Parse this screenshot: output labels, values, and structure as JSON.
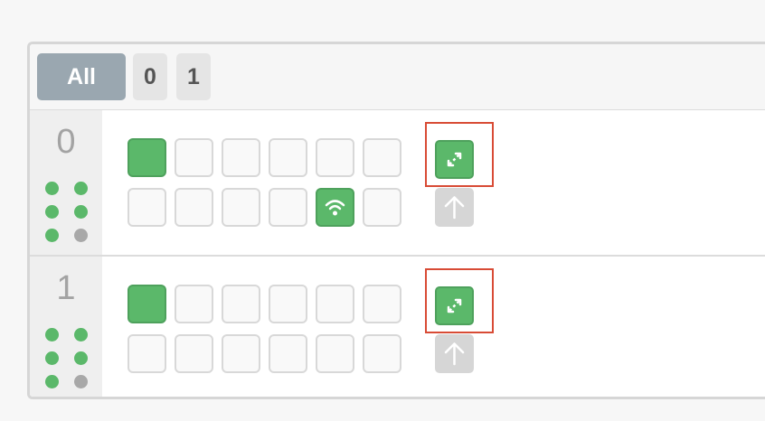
{
  "tabs": {
    "all_label": "All",
    "tab0_label": "0",
    "tab1_label": "1"
  },
  "rows": [
    {
      "label": "0",
      "status_dots": [
        "green",
        "green",
        "green",
        "green",
        "green",
        "gray"
      ],
      "slots_top": [
        "on",
        "off",
        "off",
        "off",
        "off",
        "off"
      ],
      "slots_bottom": [
        "off",
        "off",
        "off",
        "off",
        "wifi-on",
        "off"
      ],
      "actions": [
        "expand-icon",
        "upload-arrow-icon"
      ]
    },
    {
      "label": "1",
      "status_dots": [
        "green",
        "green",
        "green",
        "green",
        "green",
        "gray"
      ],
      "slots_top": [
        "on",
        "off",
        "off",
        "off",
        "off",
        "off"
      ],
      "slots_bottom": [
        "off",
        "off",
        "off",
        "off",
        "off",
        "off"
      ],
      "actions": [
        "expand-icon",
        "upload-arrow-icon"
      ]
    }
  ],
  "colors": {
    "green": "#5bb86a",
    "gray": "#a8a8a8",
    "active_tab": "#9aa7b0",
    "highlight": "#d84b35"
  }
}
